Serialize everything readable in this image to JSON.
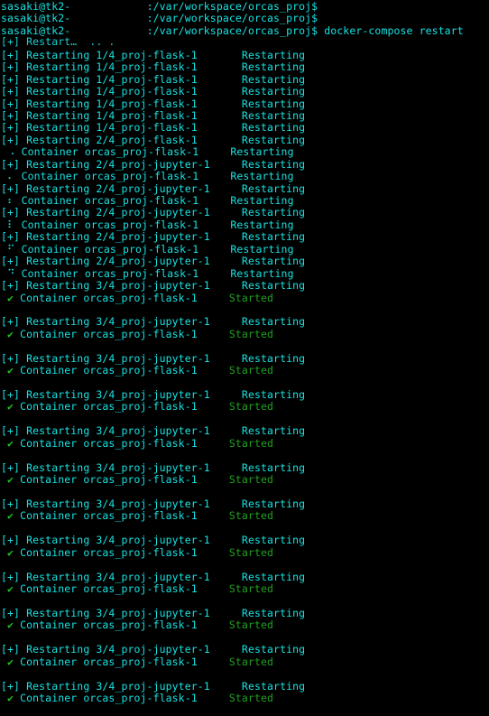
{
  "terminal": {
    "app": "terminal",
    "colors": {
      "background": "#000000",
      "foreground_cyan": "#18e2e2",
      "check_green": "#1ec81e",
      "status_green": "#21a121"
    },
    "prompt": {
      "user_host": "sasaki@tk2-",
      "redacted_host_gap": "            ",
      "path": ":/var/workspace/orcas_proj",
      "symbol": "$"
    },
    "command": "docker-compose restart",
    "labels": {
      "plus_marker": "[+]",
      "restarting_verb": "Restarting",
      "container_word": "Container",
      "status_restarting": "Restarting",
      "status_started": "Started",
      "check_glyph": "✔",
      "restart_header_fragment": "[+] Restart…  .. ."
    },
    "services": {
      "flask": "proj-flask-1",
      "jupyter": "proj-jupyter-1",
      "container_flask": "orcas_proj-flask-1"
    },
    "spinner_frames": [
      "⠠",
      "⠄",
      "⠆",
      "⠇",
      "⠋",
      "⠙",
      "⠸"
    ],
    "lines": [
      {
        "type": "prompt",
        "user_host": "sasaki@tk2-",
        "gap": "            ",
        "path": ":/var/workspace/orcas_proj$",
        "cmd": ""
      },
      {
        "type": "prompt",
        "user_host": "sasaki@tk2-",
        "gap": "            ",
        "path": ":/var/workspace/orcas_proj$",
        "cmd": ""
      },
      {
        "type": "prompt",
        "user_host": "sasaki@tk2-",
        "gap": "            ",
        "path": ":/var/workspace/orcas_proj$",
        "cmd": " docker-compose restart"
      },
      {
        "type": "fragment",
        "text": "[+] Restart…  .. ."
      },
      {
        "type": "task",
        "marker": "[+]",
        "verb": "Restarting",
        "name": "1/4_proj-flask-1",
        "status": "Restarting",
        "status_kind": "restarting"
      },
      {
        "type": "task",
        "marker": "[+]",
        "verb": "Restarting",
        "name": "1/4_proj-flask-1",
        "status": "Restarting",
        "status_kind": "restarting"
      },
      {
        "type": "task",
        "marker": "[+]",
        "verb": "Restarting",
        "name": "1/4_proj-flask-1",
        "status": "Restarting",
        "status_kind": "restarting"
      },
      {
        "type": "task",
        "marker": "[+]",
        "verb": "Restarting",
        "name": "1/4_proj-flask-1",
        "status": "Restarting",
        "status_kind": "restarting"
      },
      {
        "type": "task",
        "marker": "[+]",
        "verb": "Restarting",
        "name": "1/4_proj-flask-1",
        "status": "Restarting",
        "status_kind": "restarting"
      },
      {
        "type": "task",
        "marker": "[+]",
        "verb": "Restarting",
        "name": "1/4_proj-flask-1",
        "status": "Restarting",
        "status_kind": "restarting"
      },
      {
        "type": "task",
        "marker": "[+]",
        "verb": "Restarting",
        "name": "1/4_proj-flask-1",
        "status": "Restarting",
        "status_kind": "restarting"
      },
      {
        "type": "task",
        "marker": "[+]",
        "verb": "Restarting",
        "name": "2/4_proj-flask-1",
        "status": "Restarting",
        "status_kind": "restarting"
      },
      {
        "type": "container",
        "marker": "⠠",
        "marker_kind": "spinner",
        "word": "Container",
        "name": "orcas_proj-flask-1",
        "status": "Restarting",
        "status_kind": "restarting"
      },
      {
        "type": "task",
        "marker": "[+]",
        "verb": "Restarting",
        "name": "2/4_proj-jupyter-1",
        "status": "Restarting",
        "status_kind": "restarting"
      },
      {
        "type": "container",
        "marker": "⠄",
        "marker_kind": "spinner",
        "word": "Container",
        "name": "orcas_proj-flask-1",
        "status": "Restarting",
        "status_kind": "restarting"
      },
      {
        "type": "task",
        "marker": "[+]",
        "verb": "Restarting",
        "name": "2/4_proj-jupyter-1",
        "status": "Restarting",
        "status_kind": "restarting"
      },
      {
        "type": "container",
        "marker": "⠆",
        "marker_kind": "spinner",
        "word": "Container",
        "name": "orcas_proj-flask-1",
        "status": "Restarting",
        "status_kind": "restarting"
      },
      {
        "type": "task",
        "marker": "[+]",
        "verb": "Restarting",
        "name": "2/4_proj-jupyter-1",
        "status": "Restarting",
        "status_kind": "restarting"
      },
      {
        "type": "container",
        "marker": "⠇",
        "marker_kind": "spinner",
        "word": "Container",
        "name": "orcas_proj-flask-1",
        "status": "Restarting",
        "status_kind": "restarting"
      },
      {
        "type": "task",
        "marker": "[+]",
        "verb": "Restarting",
        "name": "2/4_proj-jupyter-1",
        "status": "Restarting",
        "status_kind": "restarting"
      },
      {
        "type": "container",
        "marker": "⠋",
        "marker_kind": "spinner",
        "word": "Container",
        "name": "orcas_proj-flask-1",
        "status": "Restarting",
        "status_kind": "restarting"
      },
      {
        "type": "task",
        "marker": "[+]",
        "verb": "Restarting",
        "name": "2/4_proj-jupyter-1",
        "status": "Restarting",
        "status_kind": "restarting"
      },
      {
        "type": "container",
        "marker": "⠙",
        "marker_kind": "spinner",
        "word": "Container",
        "name": "orcas_proj-flask-1",
        "status": "Restarting",
        "status_kind": "restarting"
      },
      {
        "type": "task",
        "marker": "[+]",
        "verb": "Restarting",
        "name": "3/4_proj-jupyter-1",
        "status": "Restarting",
        "status_kind": "restarting"
      },
      {
        "type": "container",
        "marker": "✔",
        "marker_kind": "check",
        "word": "Container",
        "name": "orcas_proj-flask-1",
        "status": "Started",
        "status_kind": "started"
      },
      {
        "type": "blank"
      },
      {
        "type": "task",
        "marker": "[+]",
        "verb": "Restarting",
        "name": "3/4_proj-jupyter-1",
        "status": "Restarting",
        "status_kind": "restarting"
      },
      {
        "type": "container",
        "marker": "✔",
        "marker_kind": "check",
        "word": "Container",
        "name": "orcas_proj-flask-1",
        "status": "Started",
        "status_kind": "started"
      },
      {
        "type": "blank"
      },
      {
        "type": "task",
        "marker": "[+]",
        "verb": "Restarting",
        "name": "3/4_proj-jupyter-1",
        "status": "Restarting",
        "status_kind": "restarting"
      },
      {
        "type": "container",
        "marker": "✔",
        "marker_kind": "check",
        "word": "Container",
        "name": "orcas_proj-flask-1",
        "status": "Started",
        "status_kind": "started"
      },
      {
        "type": "blank"
      },
      {
        "type": "task",
        "marker": "[+]",
        "verb": "Restarting",
        "name": "3/4_proj-jupyter-1",
        "status": "Restarting",
        "status_kind": "restarting"
      },
      {
        "type": "container",
        "marker": "✔",
        "marker_kind": "check",
        "word": "Container",
        "name": "orcas_proj-flask-1",
        "status": "Started",
        "status_kind": "started"
      },
      {
        "type": "blank"
      },
      {
        "type": "task",
        "marker": "[+]",
        "verb": "Restarting",
        "name": "3/4_proj-jupyter-1",
        "status": "Restarting",
        "status_kind": "restarting"
      },
      {
        "type": "container",
        "marker": "✔",
        "marker_kind": "check",
        "word": "Container",
        "name": "orcas_proj-flask-1",
        "status": "Started",
        "status_kind": "started"
      },
      {
        "type": "blank"
      },
      {
        "type": "task",
        "marker": "[+]",
        "verb": "Restarting",
        "name": "3/4_proj-jupyter-1",
        "status": "Restarting",
        "status_kind": "restarting"
      },
      {
        "type": "container",
        "marker": "✔",
        "marker_kind": "check",
        "word": "Container",
        "name": "orcas_proj-flask-1",
        "status": "Started",
        "status_kind": "started"
      },
      {
        "type": "blank"
      },
      {
        "type": "task",
        "marker": "[+]",
        "verb": "Restarting",
        "name": "3/4_proj-jupyter-1",
        "status": "Restarting",
        "status_kind": "restarting"
      },
      {
        "type": "container",
        "marker": "✔",
        "marker_kind": "check",
        "word": "Container",
        "name": "orcas_proj-flask-1",
        "status": "Started",
        "status_kind": "started"
      },
      {
        "type": "blank"
      },
      {
        "type": "task",
        "marker": "[+]",
        "verb": "Restarting",
        "name": "3/4_proj-jupyter-1",
        "status": "Restarting",
        "status_kind": "restarting"
      },
      {
        "type": "container",
        "marker": "✔",
        "marker_kind": "check",
        "word": "Container",
        "name": "orcas_proj-flask-1",
        "status": "Started",
        "status_kind": "started"
      },
      {
        "type": "blank"
      },
      {
        "type": "task",
        "marker": "[+]",
        "verb": "Restarting",
        "name": "3/4_proj-jupyter-1",
        "status": "Restarting",
        "status_kind": "restarting"
      },
      {
        "type": "container",
        "marker": "✔",
        "marker_kind": "check",
        "word": "Container",
        "name": "orcas_proj-flask-1",
        "status": "Started",
        "status_kind": "started"
      },
      {
        "type": "blank"
      },
      {
        "type": "task",
        "marker": "[+]",
        "verb": "Restarting",
        "name": "3/4_proj-jupyter-1",
        "status": "Restarting",
        "status_kind": "restarting"
      },
      {
        "type": "container",
        "marker": "✔",
        "marker_kind": "check",
        "word": "Container",
        "name": "orcas_proj-flask-1",
        "status": "Started",
        "status_kind": "started"
      },
      {
        "type": "blank"
      },
      {
        "type": "task",
        "marker": "[+]",
        "verb": "Restarting",
        "name": "3/4_proj-jupyter-1",
        "status": "Restarting",
        "status_kind": "restarting"
      },
      {
        "type": "container",
        "marker": "✔",
        "marker_kind": "check",
        "word": "Container",
        "name": "orcas_proj-flask-1",
        "status": "Started",
        "status_kind": "started"
      },
      {
        "type": "blank"
      },
      {
        "type": "task",
        "marker": "[+]",
        "verb": "Restarting",
        "name": "3/4_proj-jupyter-1",
        "status": "Restarting",
        "status_kind": "restarting"
      },
      {
        "type": "container",
        "marker": "✔",
        "marker_kind": "check",
        "word": "Container",
        "name": "orcas_proj-flask-1",
        "status": "Started",
        "status_kind": "started"
      }
    ]
  }
}
